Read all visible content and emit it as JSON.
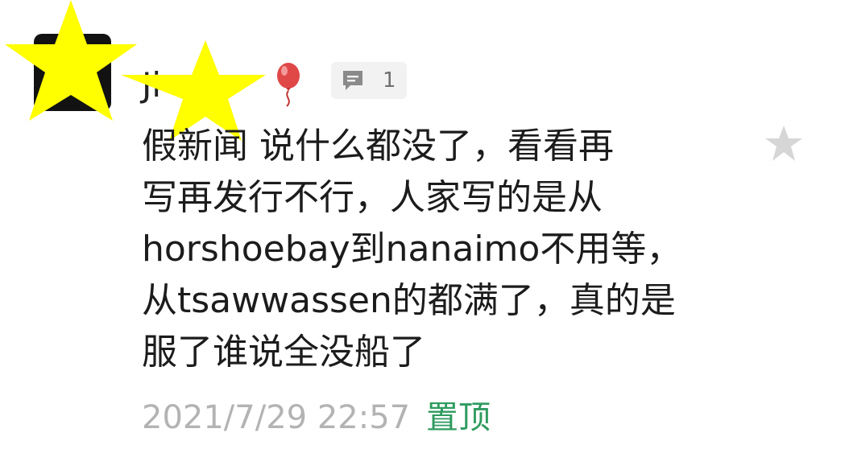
{
  "comment": {
    "user": {
      "name_visible": "Ji     u",
      "balloon_icon": "balloon-icon"
    },
    "reply_badge": {
      "icon": "comment-icon",
      "count": "1"
    },
    "body_lines": [
      "假新闻 说什么都没了，看看再",
      "写再发行不行，人家写的是从",
      "horshoebay到nanaimo不用等，",
      "从tsawwassen的都满了，真的是",
      "服了谁说全没船了"
    ],
    "timestamp": "2021/7/29 22:57",
    "pin_label": "置顶",
    "favorite_icon": "star-icon"
  },
  "colors": {
    "text": "#1c1c1c",
    "muted": "#b3b3b3",
    "accent_green": "#2e9b5f",
    "badge_bg": "#f2f2f2",
    "redaction_star": "#ffff00",
    "favorite_star": "#d6d6d6"
  }
}
